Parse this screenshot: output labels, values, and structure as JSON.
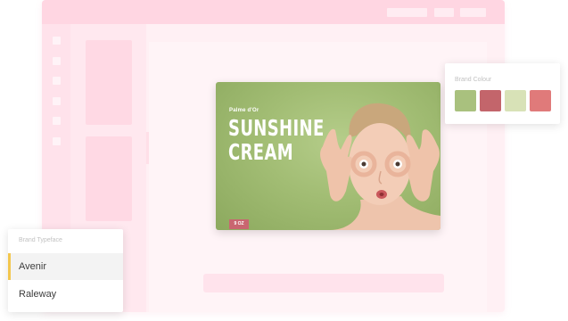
{
  "ad": {
    "brand": "Palme d'Or",
    "headline_line1": "SUNSHINE",
    "headline_line2": "CREAM",
    "badge": "9 OZ",
    "photo_icon": "face-photo"
  },
  "brand_colour": {
    "label": "Brand Colour",
    "swatches": [
      "#a9c17e",
      "#c3656b",
      "#d8e2b7",
      "#e07a7a"
    ]
  },
  "brand_typeface": {
    "label": "Brand Typeface",
    "options": [
      "Avenir",
      "Raleway"
    ],
    "selected": "Avenir",
    "selected_accent": "#f3c74e"
  },
  "theme": {
    "window_bg": "#fff0f4",
    "titlebar": "#ffd6e2"
  }
}
